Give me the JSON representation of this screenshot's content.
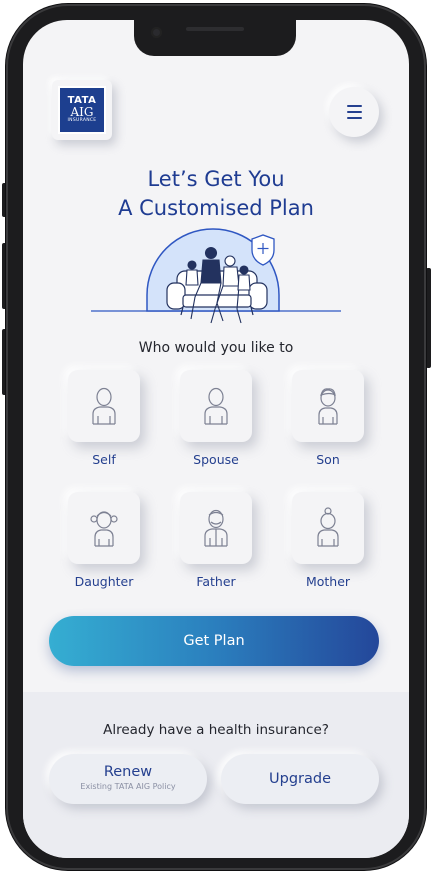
{
  "header": {
    "logo": {
      "line1": "TATA",
      "line2": "AIG",
      "line3": "INSURANCE"
    },
    "menu_icon": "hamburger-menu-icon"
  },
  "hero": {
    "title_line1": "Let’s Get You",
    "title_line2": "A Customised Plan",
    "illustration": "family-on-sofa-with-shield"
  },
  "prompt": "Who would you like to",
  "members": [
    {
      "label": "Self",
      "icon": "person-icon"
    },
    {
      "label": "Spouse",
      "icon": "person-icon"
    },
    {
      "label": "Son",
      "icon": "boy-icon"
    },
    {
      "label": "Daughter",
      "icon": "girl-icon"
    },
    {
      "label": "Father",
      "icon": "father-icon"
    },
    {
      "label": "Mother",
      "icon": "mother-icon"
    }
  ],
  "cta": {
    "label": "Get Plan"
  },
  "existing": {
    "question": "Already have a health insurance?",
    "renew_label": "Renew",
    "renew_sub": "Existing TATA AIG Policy",
    "upgrade_label": "Upgrade"
  },
  "colors": {
    "brand_blue": "#1f3c92",
    "logo_blue": "#1d3f8f",
    "gradient_start": "#35aed2",
    "gradient_end": "#24479a",
    "background": "#f4f4f6"
  }
}
